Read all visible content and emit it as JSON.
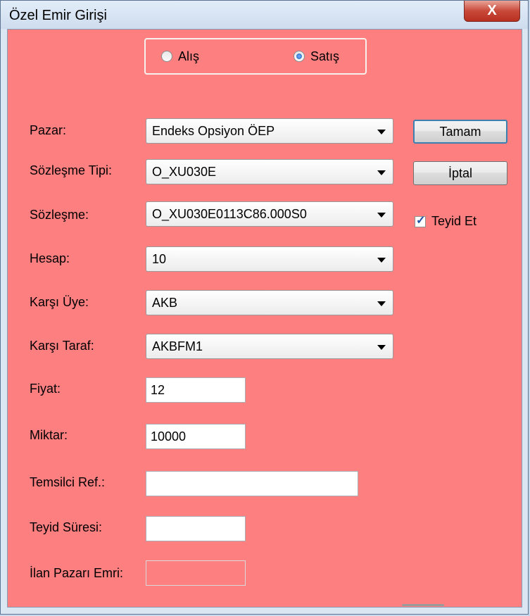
{
  "window": {
    "title": "Özel Emir Girişi",
    "close_label": "X"
  },
  "side": {
    "options": [
      {
        "label": "Alış",
        "selected": false
      },
      {
        "label": "Satış",
        "selected": true
      }
    ]
  },
  "fields": {
    "pazar": {
      "label": "Pazar:",
      "value": "Endeks Opsiyon ÖEP"
    },
    "sozlesme_tipi": {
      "label": "Sözleşme Tipi:",
      "value": "O_XU030E"
    },
    "sozlesme": {
      "label": "Sözleşme:",
      "value": "O_XU030E0113C86.000S0"
    },
    "hesap": {
      "label": "Hesap:",
      "value": "10"
    },
    "karsi_uye": {
      "label": "Karşı Üye:",
      "value": "AKB"
    },
    "karsi_taraf": {
      "label": "Karşı Taraf:",
      "value": "AKBFM1"
    },
    "fiyat": {
      "label": "Fiyat:",
      "value": "12"
    },
    "miktar": {
      "label": "Miktar:",
      "value": "10000"
    },
    "temsilci_ref": {
      "label": "Temsilci Ref.:",
      "value": ""
    },
    "teyid_suresi": {
      "label": "Teyid Süresi:",
      "value": ""
    },
    "ilan_pazari_emri": {
      "label": "İlan Pazarı Emri:",
      "value": ""
    }
  },
  "buttons": {
    "ok": "Tamam",
    "cancel": "İptal"
  },
  "confirm": {
    "label": "Teyid Et",
    "checked": true
  },
  "colors": {
    "form_bg": "#fe7f80",
    "accent": "#3c7fb1"
  }
}
